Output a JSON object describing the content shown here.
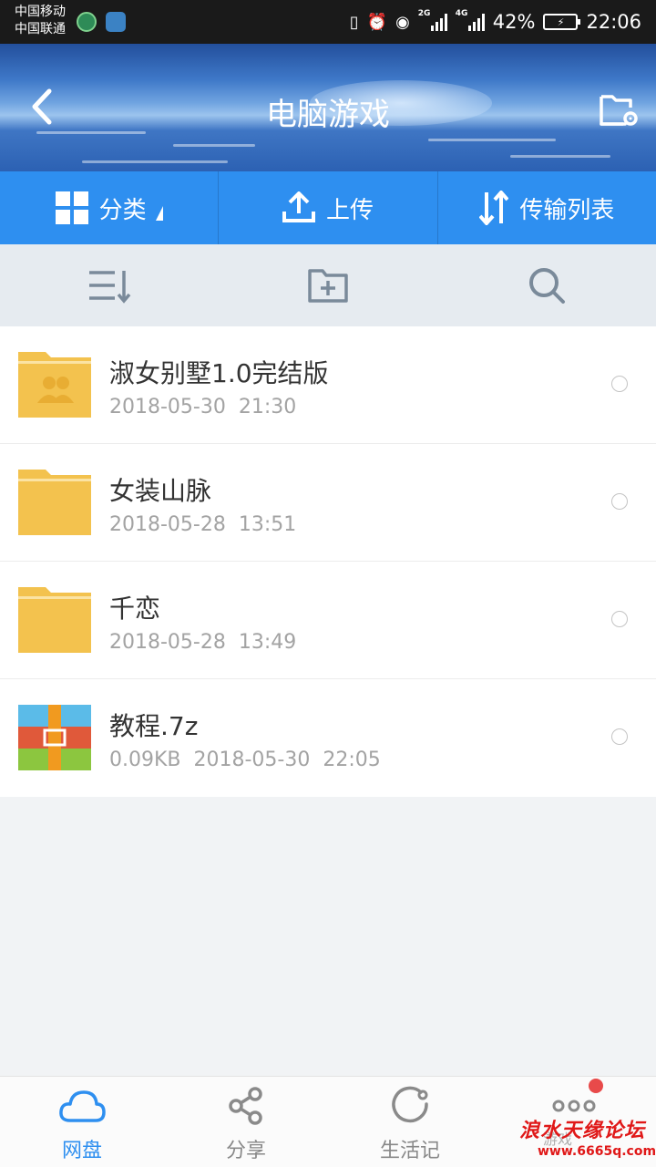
{
  "status_bar": {
    "carrier1": "中国移动",
    "carrier2": "中国联通",
    "battery_percent": "42%",
    "time": "22:06",
    "net_2g": "2G",
    "net_4g": "4G"
  },
  "header": {
    "title": "电脑游戏"
  },
  "toolbar": {
    "category_label": "分类",
    "upload_label": "上传",
    "transfer_label": "传输列表"
  },
  "files": [
    {
      "name": "淑女别墅1.0完结版",
      "meta": "2018-05-30  21:30",
      "type": "shared-folder"
    },
    {
      "name": "女装山脉",
      "meta": "2018-05-28  13:51",
      "type": "folder"
    },
    {
      "name": "千恋",
      "meta": "2018-05-28  13:49",
      "type": "folder"
    },
    {
      "name": "教程.7z",
      "meta": "0.09KB  2018-05-30  22:05",
      "type": "archive"
    }
  ],
  "bottom_nav": [
    {
      "label": "网盘",
      "active": true
    },
    {
      "label": "分享",
      "active": false
    },
    {
      "label": "生活记",
      "active": false
    },
    {
      "label": "",
      "active": false
    }
  ],
  "watermark": {
    "brand": "浪水天缘论坛",
    "url": "www.6665q.com",
    "overlay": "游戏"
  },
  "colors": {
    "accent": "#2e8ff0",
    "folder": "#f3c24e",
    "badge": "#e84a4a",
    "watermark": "#e01818"
  }
}
